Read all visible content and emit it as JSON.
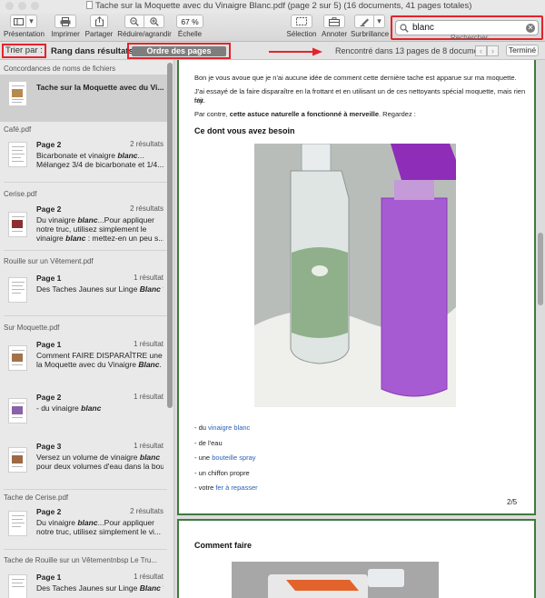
{
  "window": {
    "title": "Tache sur la Moquette avec du Vinaigre Blanc.pdf (page 2 sur 5) (16 documents, 41 pages totales)"
  },
  "toolbar": {
    "presentation": "Présentation",
    "print": "Imprimer",
    "share": "Partager",
    "zoom": "Réduire/agrandir",
    "zoom_value": "67 %",
    "scale": "Échelle",
    "selection": "Sélection",
    "annotate": "Annoter",
    "highlight": "Surbrillance",
    "search_value": "blanc",
    "search_caption": "Rechercher"
  },
  "sortbar": {
    "label": "Trier par :",
    "rank": "Rang dans résultats",
    "order": "Ordre des pages",
    "found": "Rencontré dans 13 pages de 8 documents",
    "done": "Terminé"
  },
  "sidebar": {
    "group0": "Concordances de noms de fichiers",
    "group0_title": "Tache sur la Moquette avec du Vi...",
    "groups": [
      {
        "name": "Café.pdf",
        "page": "Page 2",
        "count": "2 résultats",
        "lines": [
          "Bicarbonate et vinaigre blanc...",
          "Mélangez 3/4 de bicarbonate et 1/4..."
        ]
      },
      {
        "name": "Cerise.pdf",
        "page": "Page 2",
        "count": "2 résultats",
        "lines": [
          "Du vinaigre blanc...Pour appliquer",
          "notre truc, utilisez simplement le",
          "vinaigre blanc : mettez-en un peu s..."
        ]
      },
      {
        "name": "Rouille sur un Vêtement.pdf",
        "page": "Page 1",
        "count": "1 résultat",
        "lines": [
          "Des Taches Jaunes sur Linge Blanc ?"
        ]
      },
      {
        "name": "Sur Moquette.pdf",
        "page": "Page 1",
        "count": "1 résultat",
        "lines": [
          "Comment FAIRE DISPARAÎTRE une ...",
          "la Moquette avec du Vinaigre Blanc."
        ]
      },
      {
        "name": "",
        "page": "Page 2",
        "count": "1 résultat",
        "lines": [
          "- du vinaigre blanc"
        ]
      },
      {
        "name": "",
        "page": "Page 3",
        "count": "1 résultat",
        "lines": [
          "Versez un volume de vinaigre blanc",
          "pour deux volumes d'eau dans la bou..."
        ]
      },
      {
        "name": "Tache de Cerise.pdf",
        "page": "Page 2",
        "count": "2 résultats",
        "lines": [
          "Du vinaigre blanc...Pour appliquer",
          "notre truc, utilisez simplement le vi..."
        ]
      },
      {
        "name": "Tache de Rouille sur un Vêtementnbsp Le Tru...",
        "page": "Page 1",
        "count": "1 résultat",
        "lines": [
          "Des Taches Jaunes sur Linge Blanc ?"
        ]
      }
    ]
  },
  "document": {
    "p1": "Bon je vous avoue que je n'ai aucune idée de comment cette dernière tache est apparue sur ma moquette.",
    "p2a": "J'ai essayé de la faire disparaître en la frottant et en utilisant un de ces nettoyants spécial moquette, mais rien n'y",
    "p2b": "fait.",
    "p3_pre": "Par contre, ",
    "p3_bold": "cette astuce naturelle a fonctionné à merveille",
    "p3_post": ". Regardez :",
    "heading1": "Ce dont vous avez besoin",
    "list": [
      {
        "prefix": "- du ",
        "link": "vinaigre blanc",
        "suffix": ""
      },
      {
        "prefix": "- de l'eau",
        "link": "",
        "suffix": ""
      },
      {
        "prefix": "- une ",
        "link": "bouteille spray",
        "suffix": ""
      },
      {
        "prefix": "- un chiffon propre",
        "link": "",
        "suffix": ""
      },
      {
        "prefix": "- votre ",
        "link": "fer à repasser",
        "suffix": ""
      }
    ],
    "page_number": "2/5",
    "heading2": "Comment faire"
  },
  "colors": {
    "highlight_red": "#e4232b",
    "page_border_green": "#3f7a3f",
    "link_blue": "#2a62b6"
  }
}
